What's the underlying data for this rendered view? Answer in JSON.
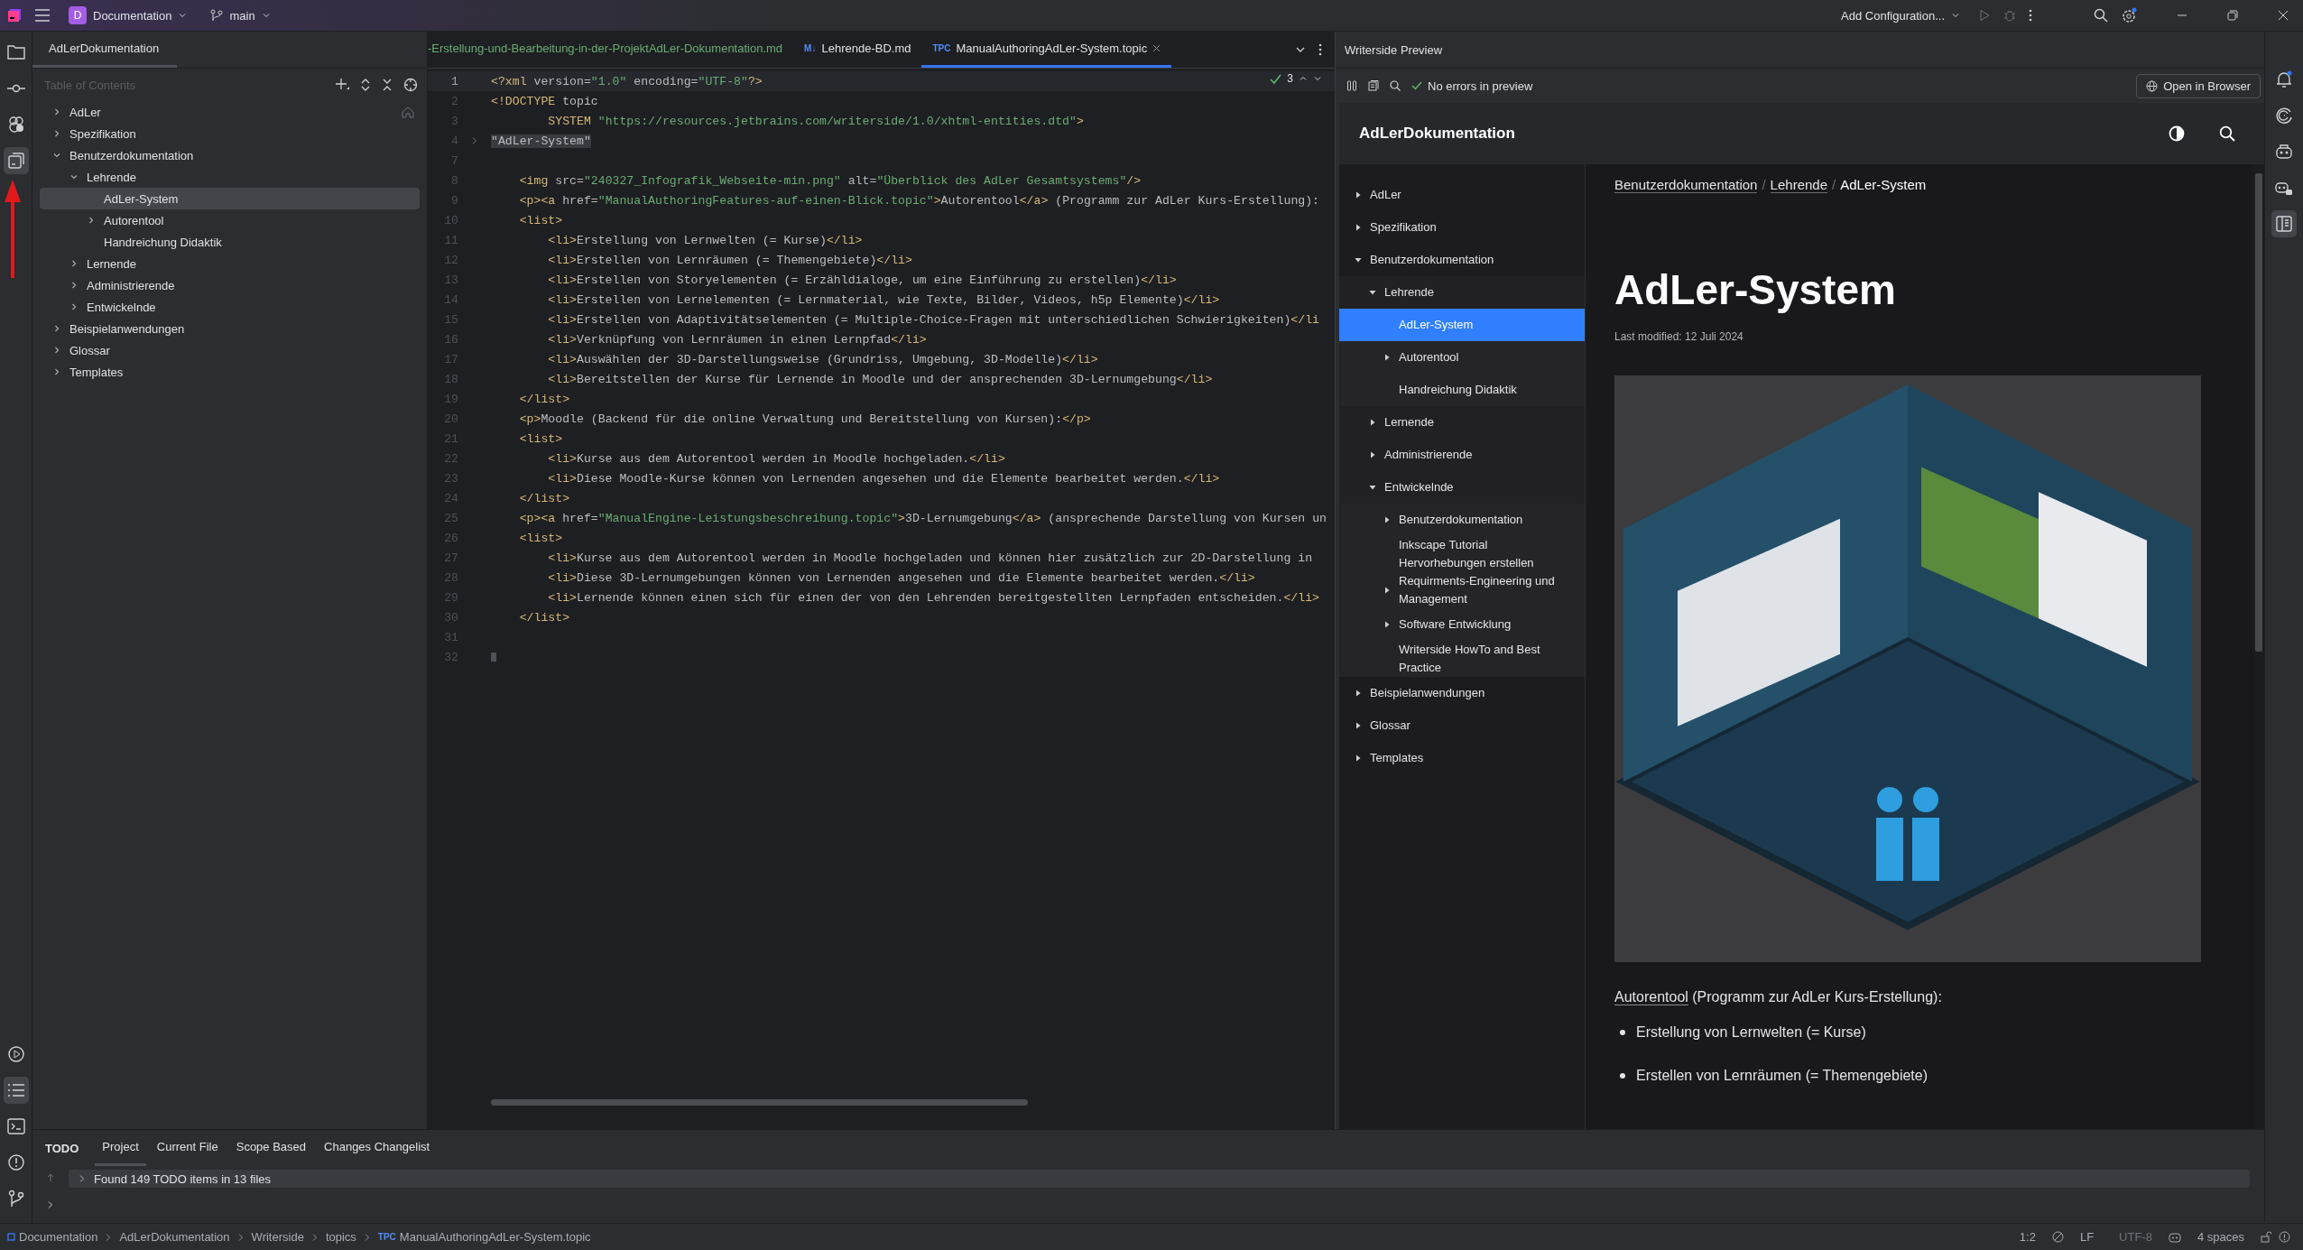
{
  "topbar": {
    "project_badge": "D",
    "project": "Documentation",
    "branch": "main",
    "run_config": "Add Configuration..."
  },
  "left_tools": [
    {
      "kind": "folder",
      "selected": false
    },
    {
      "kind": "commit",
      "selected": false
    },
    {
      "kind": "plugin",
      "selected": false
    },
    {
      "kind": "toc",
      "selected": true
    }
  ],
  "left_tools_bottom": [
    {
      "kind": "run",
      "selected": false
    },
    {
      "kind": "todo",
      "selected": true
    },
    {
      "kind": "terminal",
      "selected": false
    },
    {
      "kind": "problems",
      "selected": false
    },
    {
      "kind": "git",
      "selected": false
    }
  ],
  "right_tools": [
    {
      "kind": "bell",
      "selected": false
    },
    {
      "kind": "swirl",
      "selected": false
    },
    {
      "kind": "robot",
      "selected": false
    },
    {
      "kind": "robot-chat",
      "selected": false
    },
    {
      "kind": "preview",
      "selected": true
    }
  ],
  "toc_panel": {
    "tab": "AdLerDokumentation",
    "heading": "Table of Contents",
    "items": [
      {
        "label": "AdLer",
        "kind": "group",
        "expanded": false,
        "selected": false
      },
      {
        "label": "Spezifikation",
        "kind": "group",
        "expanded": false,
        "selected": false
      },
      {
        "label": "Benutzerdokumentation",
        "kind": "group",
        "expanded": true,
        "selected": false,
        "children": [
          {
            "label": "Lehrende",
            "kind": "group",
            "expanded": true,
            "selected": false,
            "children": [
              {
                "label": "AdLer-System",
                "kind": "page",
                "selected": true
              },
              {
                "label": "Autorentool",
                "kind": "group",
                "expanded": false,
                "selected": false
              },
              {
                "label": "Handreichung Didaktik",
                "kind": "page",
                "selected": false
              }
            ]
          },
          {
            "label": "Lernende",
            "kind": "group",
            "expanded": false,
            "selected": false
          },
          {
            "label": "Administrierende",
            "kind": "group",
            "expanded": false,
            "selected": false
          },
          {
            "label": "Entwickelnde",
            "kind": "group",
            "expanded": false,
            "selected": false
          }
        ]
      },
      {
        "label": "Beispielanwendungen",
        "kind": "group",
        "expanded": false,
        "selected": false
      },
      {
        "label": "Glossar",
        "kind": "group",
        "expanded": false,
        "selected": false
      },
      {
        "label": "Templates",
        "kind": "group",
        "expanded": false,
        "selected": false
      }
    ]
  },
  "editor": {
    "tabs": [
      {
        "kind": "plain",
        "name": "-Erstellung-und-Bearbeitung-in-der-ProjektAdLer-Dokumentation.md",
        "added": true,
        "selected": false
      },
      {
        "kind": "markdown",
        "badge": "M↓",
        "name": "Lehrende-BD.md",
        "added": false,
        "selected": false
      },
      {
        "kind": "topic",
        "badge": "TPC",
        "name": "ManualAuthoringAdLer-System.topic",
        "added": false,
        "selected": true
      }
    ],
    "inspection": "3",
    "lines": [
      {
        "number": "1",
        "current": true,
        "tokens": [
          {
            "kind": "tag",
            "text": "<?xml"
          },
          {
            "kind": "attr",
            "text": " version="
          },
          {
            "kind": "str",
            "text": "\"1.0\""
          },
          {
            "kind": "attr",
            "text": " encoding="
          },
          {
            "kind": "str",
            "text": "\"UTF-8\""
          },
          {
            "kind": "tag",
            "text": "?>"
          }
        ]
      },
      {
        "number": "2",
        "current": false,
        "tokens": [
          {
            "kind": "tag",
            "text": "<!DOCTYPE"
          },
          {
            "kind": "text",
            "text": " topic"
          }
        ]
      },
      {
        "number": "3",
        "current": false,
        "tokens": [
          {
            "kind": "tag",
            "text": "        SYSTEM "
          },
          {
            "kind": "str",
            "text": "\"https://resources.jetbrains.com/writerside/1.0/xhtml-entities.dtd\""
          },
          {
            "kind": "tag",
            "text": ">"
          }
        ]
      },
      {
        "number": "4",
        "current": false,
        "folded": true,
        "tokens": [
          {
            "kind": "fold",
            "text": "\"AdLer-System\""
          }
        ]
      },
      {
        "number": "7",
        "current": false
      },
      {
        "number": "8",
        "current": false,
        "tokens": [
          {
            "kind": "tag",
            "text": "    <img"
          },
          {
            "kind": "attr",
            "text": " src="
          },
          {
            "kind": "str",
            "text": "\"240327_Infografik_Webseite-min.png\""
          },
          {
            "kind": "attr",
            "text": " alt="
          },
          {
            "kind": "str",
            "text": "\"Überblick des AdLer Gesamtsystems\""
          },
          {
            "kind": "tag",
            "text": "/>"
          }
        ]
      },
      {
        "number": "9",
        "current": false,
        "tokens": [
          {
            "kind": "tag",
            "text": "    <p><a"
          },
          {
            "kind": "attr",
            "text": " href="
          },
          {
            "kind": "str",
            "text": "\"ManualAuthoringFeatures-auf-einen-Blick.topic\""
          },
          {
            "kind": "tag",
            "text": ">"
          },
          {
            "kind": "text",
            "text": "Autorentool"
          },
          {
            "kind": "tag",
            "text": "</a>"
          },
          {
            "kind": "text",
            "text": " (Programm zur AdLer Kurs-Erstellung):"
          }
        ]
      },
      {
        "number": "10",
        "current": false,
        "tokens": [
          {
            "kind": "tag",
            "text": "    <list>"
          }
        ]
      },
      {
        "number": "11",
        "current": false,
        "tokens": [
          {
            "kind": "tag",
            "text": "        <li>"
          },
          {
            "kind": "text",
            "text": "Erstellung von Lernwelten (= Kurse)"
          },
          {
            "kind": "tag",
            "text": "</li>"
          }
        ]
      },
      {
        "number": "12",
        "current": false,
        "tokens": [
          {
            "kind": "tag",
            "text": "        <li>"
          },
          {
            "kind": "text",
            "text": "Erstellen von Lernräumen (= Themengebiete)"
          },
          {
            "kind": "tag",
            "text": "</li>"
          }
        ]
      },
      {
        "number": "13",
        "current": false,
        "tokens": [
          {
            "kind": "tag",
            "text": "        <li>"
          },
          {
            "kind": "text",
            "text": "Erstellen von Storyelementen (= Erzähldialoge, um eine Einführung zu erstellen)"
          },
          {
            "kind": "tag",
            "text": "</li>"
          }
        ]
      },
      {
        "number": "14",
        "current": false,
        "tokens": [
          {
            "kind": "tag",
            "text": "        <li>"
          },
          {
            "kind": "text",
            "text": "Erstellen von Lernelementen (= Lernmaterial, wie Texte, Bilder, Videos, h5p Elemente)"
          },
          {
            "kind": "tag",
            "text": "</li>"
          }
        ]
      },
      {
        "number": "15",
        "current": false,
        "tokens": [
          {
            "kind": "tag",
            "text": "        <li>"
          },
          {
            "kind": "text",
            "text": "Erstellen von Adaptivitätselementen (= Multiple-Choice-Fragen mit unterschiedlichen Schwierigkeiten)"
          },
          {
            "kind": "tag",
            "text": "</li"
          }
        ]
      },
      {
        "number": "16",
        "current": false,
        "tokens": [
          {
            "kind": "tag",
            "text": "        <li>"
          },
          {
            "kind": "text",
            "text": "Verknüpfung von Lernräumen in einen Lernpfad"
          },
          {
            "kind": "tag",
            "text": "</li>"
          }
        ]
      },
      {
        "number": "17",
        "current": false,
        "tokens": [
          {
            "kind": "tag",
            "text": "        <li>"
          },
          {
            "kind": "text",
            "text": "Auswählen der 3D-Darstellungsweise (Grundriss, Umgebung, 3D-Modelle)"
          },
          {
            "kind": "tag",
            "text": "</li>"
          }
        ]
      },
      {
        "number": "18",
        "current": false,
        "tokens": [
          {
            "kind": "tag",
            "text": "        <li>"
          },
          {
            "kind": "text",
            "text": "Bereitstellen der Kurse für Lernende in Moodle und der ansprechenden 3D-Lernumgebung"
          },
          {
            "kind": "tag",
            "text": "</li>"
          }
        ]
      },
      {
        "number": "19",
        "current": false,
        "tokens": [
          {
            "kind": "tag",
            "text": "    </list>"
          }
        ]
      },
      {
        "number": "20",
        "current": false,
        "tokens": [
          {
            "kind": "tag",
            "text": "    <p>"
          },
          {
            "kind": "text",
            "text": "Moodle (Backend für die online Verwaltung und Bereitstellung von Kursen):"
          },
          {
            "kind": "tag",
            "text": "</p>"
          }
        ]
      },
      {
        "number": "21",
        "current": false,
        "tokens": [
          {
            "kind": "tag",
            "text": "    <list>"
          }
        ]
      },
      {
        "number": "22",
        "current": false,
        "tokens": [
          {
            "kind": "tag",
            "text": "        <li>"
          },
          {
            "kind": "text",
            "text": "Kurse aus dem Autorentool werden in Moodle hochgeladen."
          },
          {
            "kind": "tag",
            "text": "</li>"
          }
        ]
      },
      {
        "number": "23",
        "current": false,
        "tokens": [
          {
            "kind": "tag",
            "text": "        <li>"
          },
          {
            "kind": "text",
            "text": "Diese Moodle-Kurse können von Lernenden angesehen und die Elemente bearbeitet werden."
          },
          {
            "kind": "tag",
            "text": "</li>"
          }
        ]
      },
      {
        "number": "24",
        "current": false,
        "tokens": [
          {
            "kind": "tag",
            "text": "    </list>"
          }
        ]
      },
      {
        "number": "25",
        "current": false,
        "tokens": [
          {
            "kind": "tag",
            "text": "    <p><a"
          },
          {
            "kind": "attr",
            "text": " href="
          },
          {
            "kind": "str",
            "text": "\"ManualEngine-Leistungsbeschreibung.topic\""
          },
          {
            "kind": "tag",
            "text": ">"
          },
          {
            "kind": "text",
            "text": "3D-Lernumgebung"
          },
          {
            "kind": "tag",
            "text": "</a>"
          },
          {
            "kind": "text",
            "text": " (ansprechende Darstellung von Kursen un"
          }
        ]
      },
      {
        "number": "26",
        "current": false,
        "tokens": [
          {
            "kind": "tag",
            "text": "    <list>"
          }
        ]
      },
      {
        "number": "27",
        "current": false,
        "tokens": [
          {
            "kind": "tag",
            "text": "        <li>"
          },
          {
            "kind": "text",
            "text": "Kurse aus dem Autorentool werden in Moodle hochgeladen und können hier zusätzlich zur 2D-Darstellung in"
          }
        ]
      },
      {
        "number": "28",
        "current": false,
        "tokens": [
          {
            "kind": "tag",
            "text": "        <li>"
          },
          {
            "kind": "text",
            "text": "Diese 3D-Lernumgebungen können von Lernenden angesehen und die Elemente bearbeitet werden."
          },
          {
            "kind": "tag",
            "text": "</li>"
          }
        ]
      },
      {
        "number": "29",
        "current": false,
        "tokens": [
          {
            "kind": "tag",
            "text": "        <li>"
          },
          {
            "kind": "text",
            "text": "Lernende können einen sich für einen der von den Lehrenden bereitgestellten Lernpfaden entscheiden."
          },
          {
            "kind": "tag",
            "text": "</li>"
          }
        ]
      },
      {
        "number": "30",
        "current": false,
        "tokens": [
          {
            "kind": "tag",
            "text": "    </list>"
          }
        ]
      },
      {
        "number": "31",
        "current": false
      },
      {
        "number": "32",
        "current": false
      }
    ]
  },
  "preview": {
    "title": "Writerside Preview",
    "status": "No errors in preview",
    "open_button": "Open in Browser",
    "site_title": "AdLerDokumentation",
    "nav": [
      {
        "label": "AdLer",
        "kind": "group",
        "expanded": false,
        "selected": false
      },
      {
        "label": "Spezifikation",
        "kind": "group",
        "expanded": false,
        "selected": false
      },
      {
        "label": "Benutzerdokumentation",
        "kind": "group",
        "expanded": true,
        "selected": false,
        "children": [
          {
            "label": "Lehrende",
            "kind": "group",
            "expanded": true,
            "selected": false,
            "children": [
              {
                "label": "AdLer-System",
                "kind": "page",
                "selected": true
              },
              {
                "label": "Autorentool",
                "kind": "group",
                "expanded": false,
                "selected": false
              },
              {
                "label": "Handreichung Didaktik",
                "kind": "page",
                "selected": false
              }
            ]
          },
          {
            "label": "Lernende",
            "kind": "group",
            "expanded": false,
            "selected": false
          },
          {
            "label": "Administrierende",
            "kind": "group",
            "expanded": false,
            "selected": false
          },
          {
            "label": "Entwickelnde",
            "kind": "group",
            "expanded": true,
            "selected": false,
            "children": [
              {
                "label": "Benutzerdokumentation",
                "kind": "group",
                "expanded": false,
                "selected": false
              },
              {
                "label": "Inkscape Tutorial Hervorhebungen erstellen",
                "kind": "page",
                "selected": false
              },
              {
                "label": "Requirments-Engineering und Management",
                "kind": "group",
                "expanded": false,
                "selected": false
              },
              {
                "label": "Software Entwicklung",
                "kind": "group",
                "expanded": false,
                "selected": false
              },
              {
                "label": "Writerside HowTo and Best Practice",
                "kind": "page",
                "selected": false
              }
            ]
          }
        ]
      },
      {
        "label": "Beispielanwendungen",
        "kind": "group",
        "expanded": false,
        "selected": false
      },
      {
        "label": "Glossar",
        "kind": "group",
        "expanded": false,
        "selected": false
      },
      {
        "label": "Templates",
        "kind": "group",
        "expanded": false,
        "selected": false
      }
    ],
    "breadcrumb": [
      {
        "kind": "link",
        "text": "Benutzerdokumentation"
      },
      {
        "kind": "sep",
        "text": "/"
      },
      {
        "kind": "link",
        "text": "Lehrende"
      },
      {
        "kind": "sep",
        "text": "/"
      },
      {
        "kind": "current",
        "text": "AdLer-System"
      }
    ],
    "heading": "AdLer-System",
    "modified": "Last modified: 12 Juli 2024",
    "paragraph": {
      "link": "Autorentool",
      "text": " (Programm zur AdLer Kurs-Erstellung):"
    },
    "bullets": [
      "Erstellung von Lernwelten (= Kurse)",
      "Erstellen von Lernräumen (= Themengebiete)"
    ]
  },
  "todo": {
    "title": "TODO",
    "tabs": [
      {
        "label": "Project",
        "selected": true
      },
      {
        "label": "Current File",
        "selected": false
      },
      {
        "label": "Scope Based",
        "selected": false
      },
      {
        "label": "Changes Changelist",
        "selected": false
      }
    ],
    "result": "Found 149 TODO items in 13 files"
  },
  "status_bar": {
    "path": [
      {
        "kind": "module",
        "text": "Documentation"
      },
      {
        "kind": "folder",
        "text": "AdLerDokumentation"
      },
      {
        "kind": "folder",
        "text": "Writerside"
      },
      {
        "kind": "folder",
        "text": "topics"
      },
      {
        "kind": "topic",
        "badge": "TPC",
        "text": "ManualAuthoringAdLer-System.topic"
      }
    ],
    "position": "1:2",
    "line_ending": "LF",
    "encoding": "UTF-8",
    "indent": "4 spaces"
  }
}
